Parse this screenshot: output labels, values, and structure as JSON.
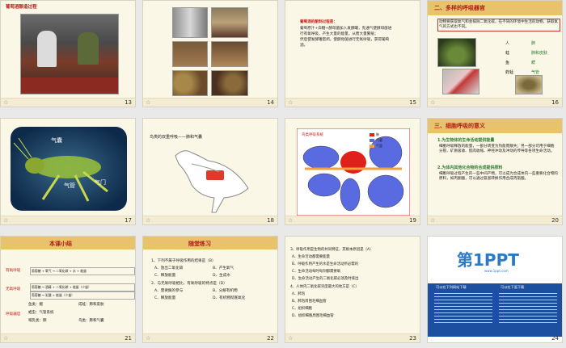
{
  "slides": [
    {
      "num": "13",
      "title": "葡萄酒酿造过程"
    },
    {
      "num": "14"
    },
    {
      "num": "15",
      "lines": [
        "葡萄酒的酿制过程是：",
        "葡萄原汁+白糖+酵母菌加入发酵罐，先通气使酵母菌进",
        "行有氧呼吸，产生大量的能量，从而大量繁殖；",
        "然后使发酵罐密闭，使酵母菌进行无氧呼吸，获得葡萄",
        "酒。"
      ]
    },
    {
      "num": "16",
      "title": "二、多样的呼吸器官",
      "intro": "动物要获取氧气和会排除二氧化碳，在不同的环境中生活的动物，获取氧气的方式也不同。",
      "organs": [
        {
          "animal": "人",
          "organ": "肺"
        },
        {
          "animal": "蛙",
          "organ": "肺和皮肤"
        },
        {
          "animal": "鱼",
          "organ": "鳃"
        },
        {
          "animal": "蚱蜢",
          "organ": "气管"
        }
      ]
    },
    {
      "num": "17",
      "labels": [
        "气囊",
        "气管",
        "气门"
      ]
    },
    {
      "num": "18",
      "title": "鸟类的双重呼吸——肺和气囊"
    },
    {
      "num": "19",
      "legend": [
        "肺",
        "气囊",
        "气管"
      ],
      "title": "鸟类呼吸系统"
    },
    {
      "num": "20",
      "title": "三、细胞呼吸的意义",
      "s1": "1.为生物体的生命活动提供能量",
      "p1": "细胞呼吸释放的能量，一部分转变为热能而散失；另一部分可用于细胞 分裂、矿质吸收、肌肉收缩、神经冲动及冲动的传导等各项生命活动。",
      "s2": "2.为体内其他化合物的合成提供原料",
      "p2": "细胞呼吸过程产生的一些中间产物，可以成为合成体内一些重要化合物的原料，如丙酮酸，可以通过氨基转换作用合成丙氨酸。"
    },
    {
      "num": "21",
      "title": "本课小结",
      "rows": [
        "有氧呼吸",
        "无氧呼吸",
        "呼吸器官"
      ],
      "eq1": "葡萄糖 + 氧气 → 二氧化碳 + 水 + 能量",
      "eq2": "葡萄糖 → 酒精 + 二氧化碳 + 能量（少量）",
      "eq3": "葡萄糖 → 乳酸 + 能量（少量）",
      "org": [
        "鱼类：鳃",
        "成蛙：肺和皮肤",
        "蝗虫：气管系统",
        "哺乳类：肺",
        "鸟类：肺和气囊"
      ]
    },
    {
      "num": "22",
      "title": "随堂练习",
      "q": [
        "1、下列不属于呼吸作用的结果是（B）",
        "A、放出二氧化碳",
        "B、产生氧气",
        "C、释放能量",
        "D、生成水",
        "2、与无氧呼吸相比，有氧呼吸的特点是（D）",
        "A、需要酶的参与",
        "B、分解有机物",
        "C、释放能量",
        "D、有机物彻底氧化"
      ]
    },
    {
      "num": "23",
      "q": [
        "3、呼吸作用是生物的共同特征，其根本原因是（A）",
        "A、生命活动都需要能量",
        "B、呼吸作用产生的水是生命活动所必需的",
        "C、生命活动每时每刻都需要氧",
        "D、生命活动产生的二氧化碳必须及时排出",
        "4、人体内二氧化碳浓度最大的地方是（C）",
        "A、肺泡",
        "B、肺泡周围毛细血管",
        "C、组织细胞",
        "D、组织细胞周围毛细血管"
      ]
    },
    {
      "num": "24",
      "logo": "第1PPT",
      "url": "www.1ppt.com",
      "col1": "可以在下列网站下载",
      "col2": "可以在下面下载"
    }
  ]
}
